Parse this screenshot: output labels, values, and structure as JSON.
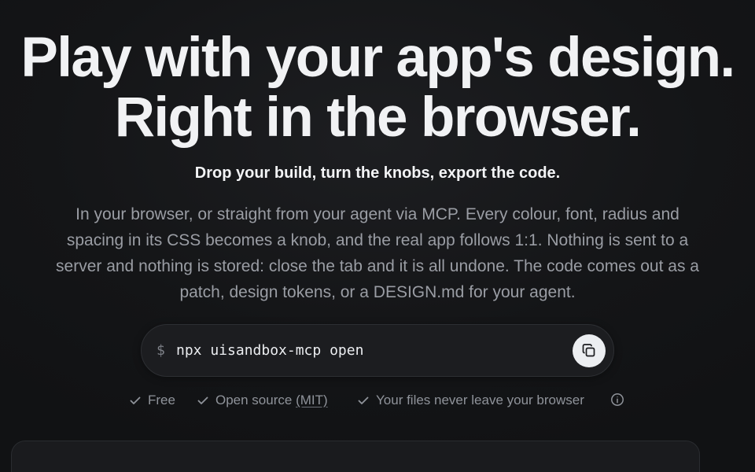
{
  "hero": {
    "headline_line1": "Play with your app's design.",
    "headline_line2": "Right in the browser.",
    "subheadline": "Drop your build, turn the knobs, export the code.",
    "description_lines": [
      "In your browser, or straight from your agent via MCP. Every colour, font, radius and",
      "spacing in its CSS becomes a knob, and the real app follows 1:1. Nothing is sent to a",
      "server and nothing is stored: close the tab and it is all undone. The code comes out as a",
      "patch, design tokens, or a DESIGN.md for your agent."
    ]
  },
  "command": {
    "prompt": "$",
    "text": "npx uisandbox-mcp open",
    "copy_icon": "copy-icon"
  },
  "features": {
    "free": "Free",
    "open_source_prefix": "Open source ",
    "open_source_link": "(MIT)",
    "files": "Your files never leave your browser",
    "check_icon": "check-icon",
    "info_icon": "info-icon"
  },
  "colors": {
    "background": "#121315",
    "headline": "#f1f2f4",
    "muted_text": "#9a9da4",
    "command_box": "#1c1d20",
    "copy_button": "#eceef1"
  }
}
